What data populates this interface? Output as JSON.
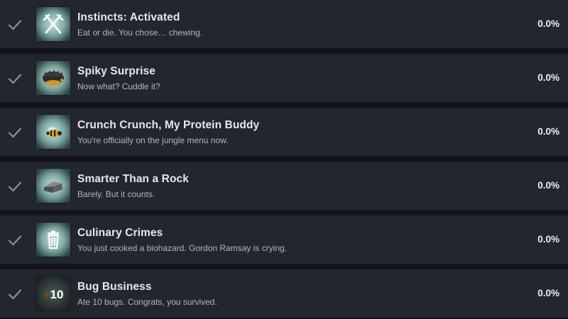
{
  "achievements": [
    {
      "icon": "fork-knife-icon",
      "title": "Instincts: Activated",
      "description": "Eat or die. You chose… chewing.",
      "percent": "0.0%"
    },
    {
      "icon": "hedgehog-icon",
      "title": "Spiky Surprise",
      "description": "Now what? Cuddle it?",
      "percent": "0.0%"
    },
    {
      "icon": "bee-icon",
      "title": "Crunch Crunch, My Protein Buddy",
      "description": "You're officially on the jungle menu now.",
      "percent": "0.0%"
    },
    {
      "icon": "rock-icon",
      "title": "Smarter Than a Rock",
      "description": "Barely. But it counts.",
      "percent": "0.0%"
    },
    {
      "icon": "trash-can-icon",
      "title": "Culinary Crimes",
      "description": "You just cooked a biohazard. Gordon Ramsay is crying.",
      "percent": "0.0%"
    },
    {
      "icon": "bug-counter-icon",
      "title": "Bug Business",
      "description": "Ate 10 bugs. Congrats, you survived.",
      "percent": "0.0%",
      "icon_text": "10"
    }
  ],
  "colors": {
    "row_background": "#23262e",
    "divider": "#121419",
    "title": "#e6e8eb",
    "description": "#b2b6bd",
    "check": "#8c9097",
    "icon_bg_light": "#b7d8d3",
    "icon_bg_dark": "#2f4a47"
  }
}
